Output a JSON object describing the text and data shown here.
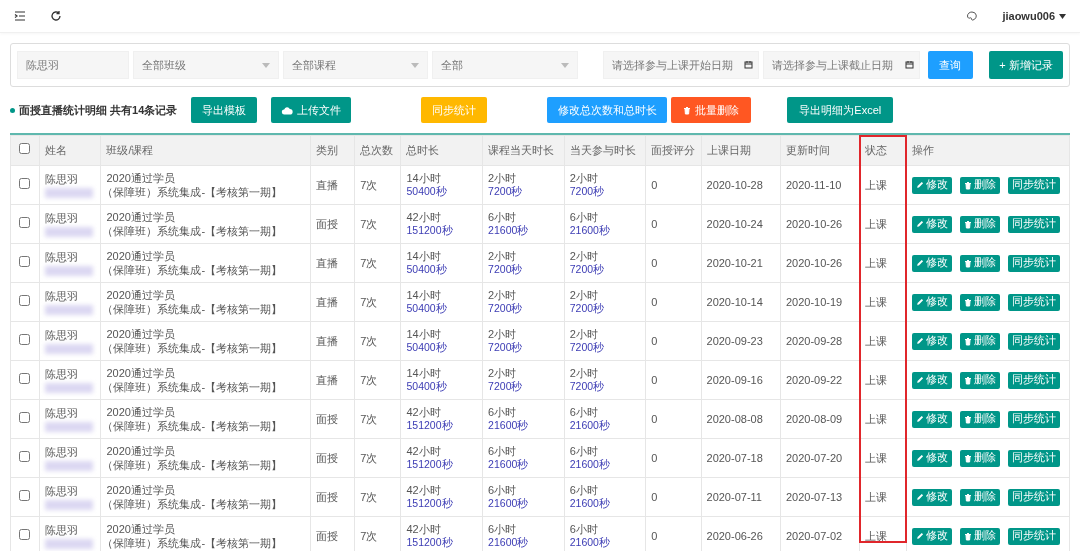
{
  "top_bar": {
    "user": "jiaowu006"
  },
  "filters": {
    "name_field": {
      "value": "陈思羽"
    },
    "selects": [
      {
        "value": "全部班级"
      },
      {
        "value": "全部课程"
      },
      {
        "value": "全部"
      }
    ],
    "date_fields": [
      {
        "placeholder": "请选择参与上课开始日期"
      },
      {
        "placeholder": "请选择参与上课截止日期"
      }
    ],
    "buttons": [
      {
        "label": "查询",
        "kind": "blue"
      },
      {
        "label": "+ 新增记录",
        "kind": "teal"
      }
    ]
  },
  "summary": "面授直播统计明细 共有14条记录",
  "toolbar": [
    {
      "label": "导出模板",
      "kind": "teal"
    },
    {
      "label": "上传文件",
      "kind": "teal"
    },
    {
      "label": "同步统计",
      "kind": "yellow"
    },
    {
      "label": "修改总次数和总时长",
      "kind": "blue"
    },
    {
      "label": "批量删除",
      "kind": "orange"
    },
    {
      "label": "导出明细为Excel",
      "kind": "teal"
    }
  ],
  "table": {
    "select_all_checked": false,
    "columns": [
      {
        "label": "姓名",
        "highlighted": false
      },
      {
        "label": "班级/课程",
        "highlighted": false
      },
      {
        "label": "类别",
        "highlighted": false
      },
      {
        "label": "总次数",
        "highlighted": false
      },
      {
        "label": "总时长",
        "highlighted": false
      },
      {
        "label": "课程当天时长",
        "highlighted": false
      },
      {
        "label": "当天参与时长",
        "highlighted": false
      },
      {
        "label": "面授评分",
        "highlighted": false
      },
      {
        "label": "上课日期",
        "highlighted": false
      },
      {
        "label": "更新时间",
        "highlighted": false
      },
      {
        "label": "状态",
        "highlighted": true
      },
      {
        "label": "操作",
        "highlighted": false
      }
    ],
    "rows": [
      {
        "checked": false,
        "name": "陈思羽",
        "class_line1": "2020通过学员",
        "class_line2": "（保障班）系统集成-【考核第一期】",
        "type": "直播",
        "count": "7次",
        "total_hours": "14小时",
        "total_seconds": "50400秒",
        "course_hours": "2小时",
        "course_seconds": "7200秒",
        "attend_hours": "2小时",
        "attend_seconds": "7200秒",
        "score": "0",
        "date": "2020-10-28",
        "updated": "2020-11-10",
        "status": "上课",
        "actions": [
          "修改",
          "删除",
          "同步统计"
        ]
      },
      {
        "checked": false,
        "name": "陈思羽",
        "class_line1": "2020通过学员",
        "class_line2": "（保障班）系统集成-【考核第一期】",
        "type": "面授",
        "count": "7次",
        "total_hours": "42小时",
        "total_seconds": "151200秒",
        "course_hours": "6小时",
        "course_seconds": "21600秒",
        "attend_hours": "6小时",
        "attend_seconds": "21600秒",
        "score": "0",
        "date": "2020-10-24",
        "updated": "2020-10-26",
        "status": "上课",
        "actions": [
          "修改",
          "删除",
          "同步统计"
        ]
      },
      {
        "checked": false,
        "name": "陈思羽",
        "class_line1": "2020通过学员",
        "class_line2": "（保障班）系统集成-【考核第一期】",
        "type": "直播",
        "count": "7次",
        "total_hours": "14小时",
        "total_seconds": "50400秒",
        "course_hours": "2小时",
        "course_seconds": "7200秒",
        "attend_hours": "2小时",
        "attend_seconds": "7200秒",
        "score": "0",
        "date": "2020-10-21",
        "updated": "2020-10-26",
        "status": "上课",
        "actions": [
          "修改",
          "删除",
          "同步统计"
        ]
      },
      {
        "checked": false,
        "name": "陈思羽",
        "class_line1": "2020通过学员",
        "class_line2": "（保障班）系统集成-【考核第一期】",
        "type": "直播",
        "count": "7次",
        "total_hours": "14小时",
        "total_seconds": "50400秒",
        "course_hours": "2小时",
        "course_seconds": "7200秒",
        "attend_hours": "2小时",
        "attend_seconds": "7200秒",
        "score": "0",
        "date": "2020-10-14",
        "updated": "2020-10-19",
        "status": "上课",
        "actions": [
          "修改",
          "删除",
          "同步统计"
        ]
      },
      {
        "checked": false,
        "name": "陈思羽",
        "class_line1": "2020通过学员",
        "class_line2": "（保障班）系统集成-【考核第一期】",
        "type": "直播",
        "count": "7次",
        "total_hours": "14小时",
        "total_seconds": "50400秒",
        "course_hours": "2小时",
        "course_seconds": "7200秒",
        "attend_hours": "2小时",
        "attend_seconds": "7200秒",
        "score": "0",
        "date": "2020-09-23",
        "updated": "2020-09-28",
        "status": "上课",
        "actions": [
          "修改",
          "删除",
          "同步统计"
        ]
      },
      {
        "checked": false,
        "name": "陈思羽",
        "class_line1": "2020通过学员",
        "class_line2": "（保障班）系统集成-【考核第一期】",
        "type": "直播",
        "count": "7次",
        "total_hours": "14小时",
        "total_seconds": "50400秒",
        "course_hours": "2小时",
        "course_seconds": "7200秒",
        "attend_hours": "2小时",
        "attend_seconds": "7200秒",
        "score": "0",
        "date": "2020-09-16",
        "updated": "2020-09-22",
        "status": "上课",
        "actions": [
          "修改",
          "删除",
          "同步统计"
        ]
      },
      {
        "checked": false,
        "name": "陈思羽",
        "class_line1": "2020通过学员",
        "class_line2": "（保障班）系统集成-【考核第一期】",
        "type": "面授",
        "count": "7次",
        "total_hours": "42小时",
        "total_seconds": "151200秒",
        "course_hours": "6小时",
        "course_seconds": "21600秒",
        "attend_hours": "6小时",
        "attend_seconds": "21600秒",
        "score": "0",
        "date": "2020-08-08",
        "updated": "2020-08-09",
        "status": "上课",
        "actions": [
          "修改",
          "删除",
          "同步统计"
        ]
      },
      {
        "checked": false,
        "name": "陈思羽",
        "class_line1": "2020通过学员",
        "class_line2": "（保障班）系统集成-【考核第一期】",
        "type": "面授",
        "count": "7次",
        "total_hours": "42小时",
        "total_seconds": "151200秒",
        "course_hours": "6小时",
        "course_seconds": "21600秒",
        "attend_hours": "6小时",
        "attend_seconds": "21600秒",
        "score": "0",
        "date": "2020-07-18",
        "updated": "2020-07-20",
        "status": "上课",
        "actions": [
          "修改",
          "删除",
          "同步统计"
        ]
      },
      {
        "checked": false,
        "name": "陈思羽",
        "class_line1": "2020通过学员",
        "class_line2": "（保障班）系统集成-【考核第一期】",
        "type": "面授",
        "count": "7次",
        "total_hours": "42小时",
        "total_seconds": "151200秒",
        "course_hours": "6小时",
        "course_seconds": "21600秒",
        "attend_hours": "6小时",
        "attend_seconds": "21600秒",
        "score": "0",
        "date": "2020-07-11",
        "updated": "2020-07-13",
        "status": "上课",
        "actions": [
          "修改",
          "删除",
          "同步统计"
        ]
      },
      {
        "checked": false,
        "name": "陈思羽",
        "class_line1": "2020通过学员",
        "class_line2": "（保障班）系统集成-【考核第一期】",
        "type": "面授",
        "count": "7次",
        "total_hours": "42小时",
        "total_seconds": "151200秒",
        "course_hours": "6小时",
        "course_seconds": "21600秒",
        "attend_hours": "6小时",
        "attend_seconds": "21600秒",
        "score": "0",
        "date": "2020-06-26",
        "updated": "2020-07-02",
        "status": "上课",
        "actions": [
          "修改",
          "删除",
          "同步统计"
        ]
      }
    ]
  }
}
